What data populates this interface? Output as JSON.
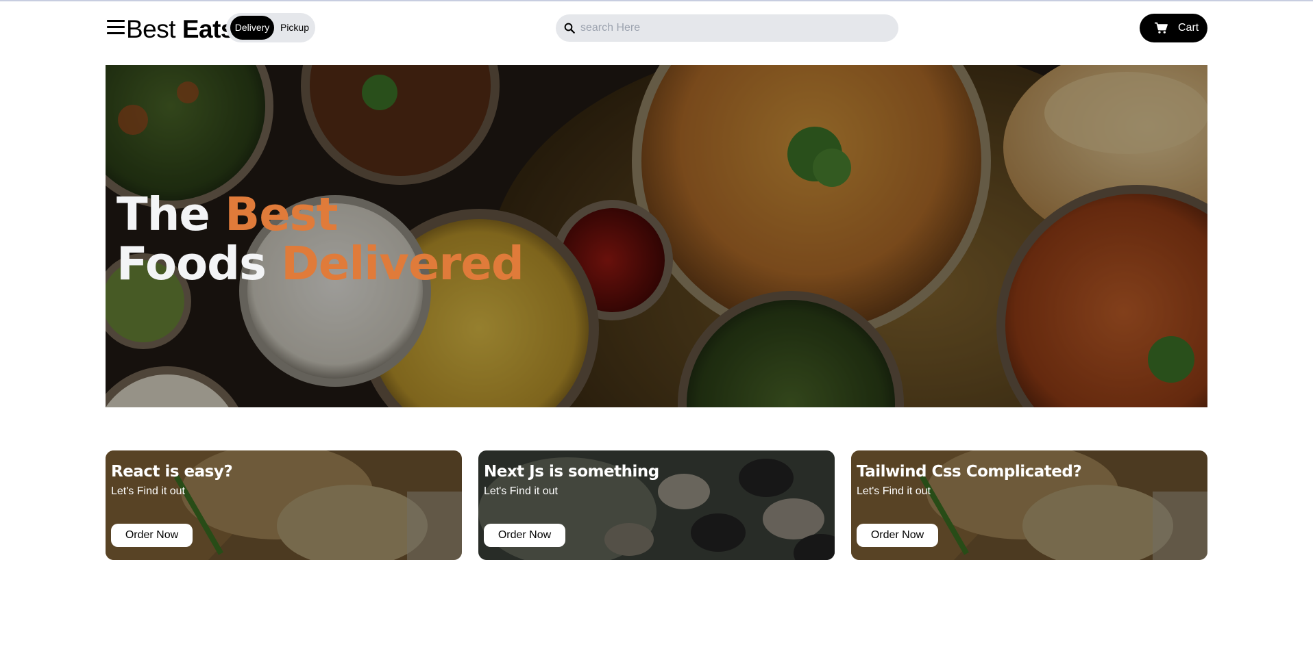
{
  "header": {
    "brand_light": "Best",
    "brand_bold": "Eats",
    "toggle": {
      "delivery": "Delivery",
      "pickup": "Pickup",
      "active": "Delivery"
    },
    "search": {
      "placeholder": "search Here",
      "value": ""
    },
    "cart_label": "Cart"
  },
  "hero": {
    "line1_white": "The",
    "line1_accent": "Best",
    "line2_white": "Foods",
    "line2_accent": "Delivered",
    "accent_color": "#e07b3a"
  },
  "cards": [
    {
      "title": "React is easy?",
      "subtitle": "Let's Find it out",
      "button": "Order Now"
    },
    {
      "title": "Next Js is something",
      "subtitle": "Let's Find it out",
      "button": "Order Now"
    },
    {
      "title": "Tailwind Css Complicated?",
      "subtitle": "Let's Find it out",
      "button": "Order Now"
    }
  ],
  "icons": {
    "menu": "hamburger-menu-icon",
    "search": "search-icon",
    "cart": "shopping-cart-icon"
  },
  "colors": {
    "primary": "#000000",
    "pill_bg": "#e5e7eb",
    "accent": "#e07b3a"
  }
}
